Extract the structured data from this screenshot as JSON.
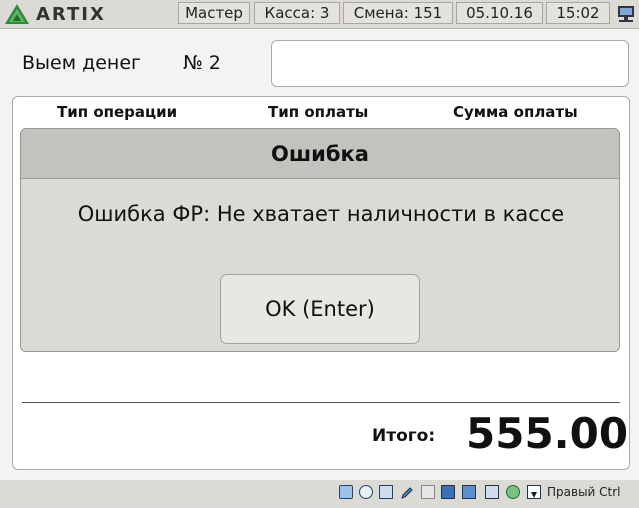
{
  "app": {
    "logo_text": "ARTIX"
  },
  "status_bar": {
    "user": "Мастер",
    "register": "Касса: 3",
    "shift": "Смена: 151",
    "date": "05.10.16",
    "time": "15:02"
  },
  "document": {
    "title": "Выем денег",
    "number": "№ 2",
    "field_value": ""
  },
  "table": {
    "columns": [
      "Тип операции",
      "Тип оплаты",
      "Сумма оплаты"
    ]
  },
  "dialog": {
    "title": "Ошибка",
    "message": "Ошибка ФР: Не хватает наличности в кассе",
    "ok_label": "OK (Enter)"
  },
  "totals": {
    "label": "Итого:",
    "value": "555.00"
  },
  "tray": {
    "icons": [
      "hdd-icon",
      "cd-icon",
      "usb-icon",
      "pen-icon",
      "folder-icon",
      "display-icon",
      "windows-icon",
      "floppy-icon",
      "network-icon",
      "arrow-down-icon"
    ],
    "host_key": "Правый Ctrl"
  },
  "colors": {
    "logo_green": "#2e8b3e",
    "background": "#dcdad5"
  }
}
